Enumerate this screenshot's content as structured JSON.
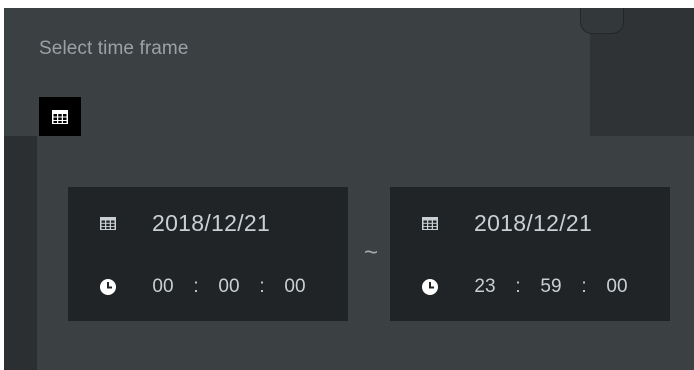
{
  "panel": {
    "title": "Select time frame"
  },
  "start": {
    "date": "2018/12/21",
    "hour": "00",
    "minute": "00",
    "second": "00"
  },
  "end": {
    "date": "2018/12/21",
    "hour": "23",
    "minute": "59",
    "second": "00"
  },
  "separators": {
    "range": "~",
    "time": ":"
  },
  "icons": {
    "calendar": "calendar-icon",
    "clock": "clock-icon"
  },
  "colors": {
    "panel_bg": "#3b4043",
    "card_bg": "#202427",
    "text": "#c9cfd2",
    "title_text": "#9aa2a6",
    "toggle_bg": "#000000"
  }
}
